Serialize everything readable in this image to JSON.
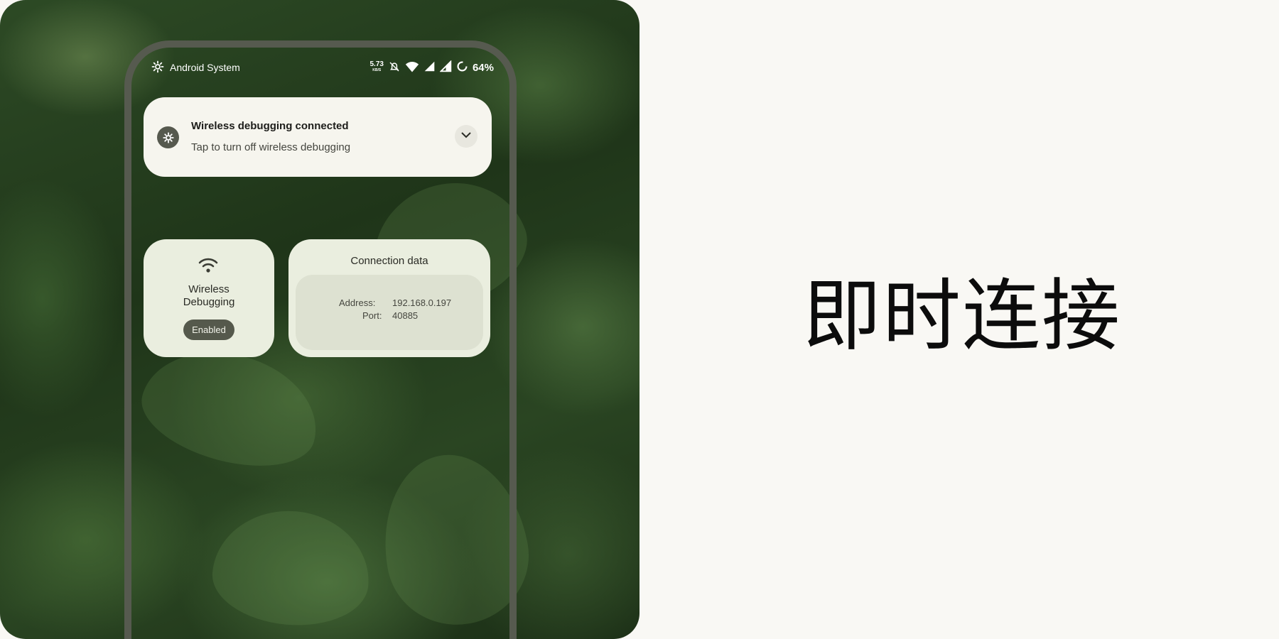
{
  "status_bar": {
    "app_name": "Android System",
    "net_speed": "5.73",
    "net_speed_unit": "KB/S",
    "battery": "64%"
  },
  "notification": {
    "title": "Wireless debugging connected",
    "body": "Tap to turn off wireless debugging"
  },
  "wireless_tile": {
    "label": "Wireless Debugging",
    "status": "Enabled"
  },
  "connection_tile": {
    "title": "Connection data",
    "address_label": "Address:",
    "address_value": "192.168.0.197",
    "port_label": "Port:",
    "port_value": "40885"
  },
  "headline": "即时连接",
  "colors": {
    "page_bg": "#f9f8f4",
    "tile_bg": "#eaeedf",
    "badge_bg": "#55594c",
    "phone_frame": "#565a4f"
  },
  "icons": [
    "gear-icon",
    "bell-off-icon",
    "wifi-icon",
    "signal-icon",
    "battery-saver-icon",
    "chevron-down-icon"
  ]
}
